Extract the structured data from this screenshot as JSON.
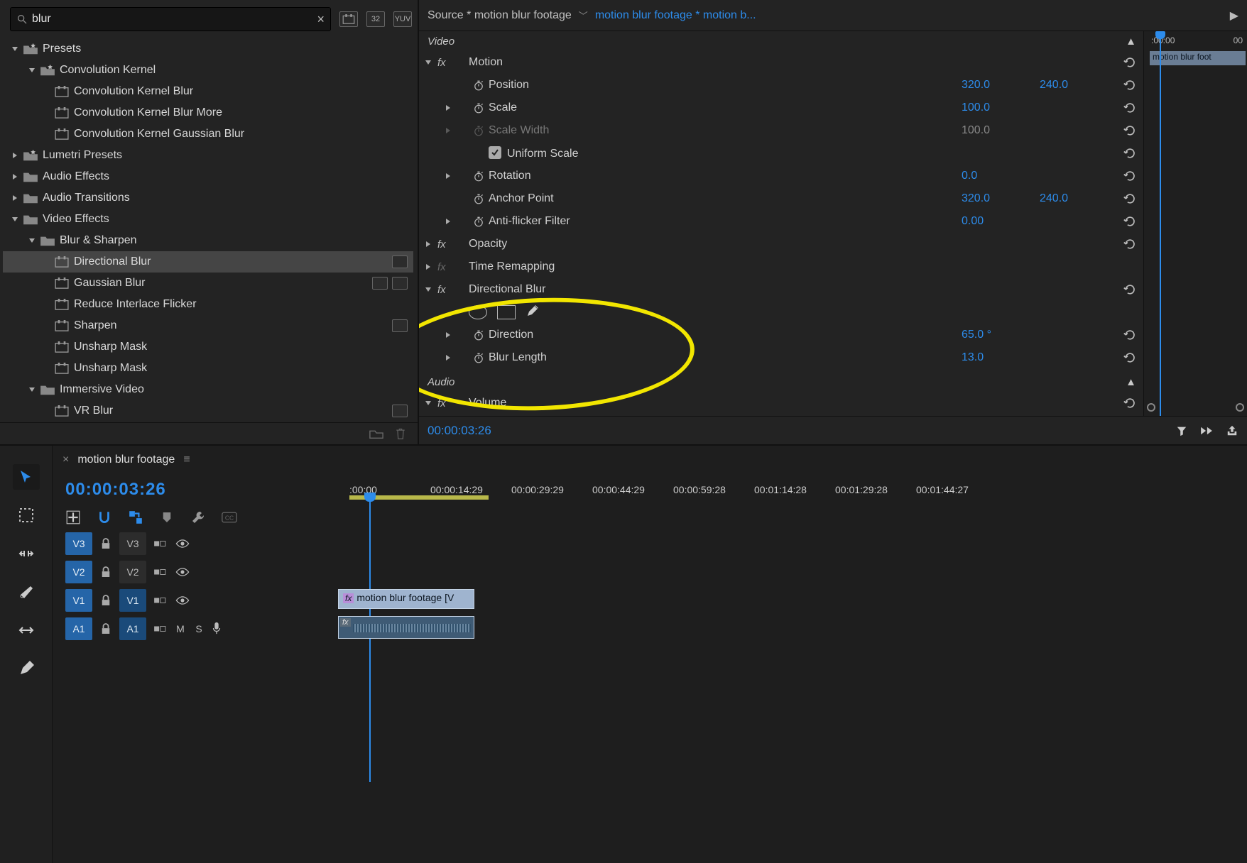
{
  "search": {
    "value": "blur"
  },
  "topbar_badges": [
    "preset",
    "32",
    "YUV"
  ],
  "tree": {
    "presets": "Presets",
    "convKernel": "Convolution Kernel",
    "ckBlur": "Convolution Kernel Blur",
    "ckBlurMore": "Convolution Kernel Blur More",
    "ckGauss": "Convolution Kernel Gaussian Blur",
    "lumetri": "Lumetri Presets",
    "audioFx": "Audio Effects",
    "audioTr": "Audio Transitions",
    "videoFx": "Video Effects",
    "blurSharpen": "Blur & Sharpen",
    "dirBlur": "Directional Blur",
    "gauss": "Gaussian Blur",
    "rif": "Reduce Interlace Flicker",
    "sharpen": "Sharpen",
    "unsharp1": "Unsharp Mask",
    "unsharp2": "Unsharp Mask",
    "immersive": "Immersive Video",
    "vrblur": "VR Blur"
  },
  "ec": {
    "source": "Source * motion blur footage",
    "sequence": "motion blur footage * motion b...",
    "videoLabel": "Video",
    "motion": "Motion",
    "position": "Position",
    "posX": "320.0",
    "posY": "240.0",
    "scale": "Scale",
    "scaleV": "100.0",
    "scaleW": "Scale Width",
    "scaleWV": "100.0",
    "uniform": "Uniform Scale",
    "rotation": "Rotation",
    "rotV": "0.0",
    "anchor": "Anchor Point",
    "anX": "320.0",
    "anY": "240.0",
    "antiF": "Anti-flicker Filter",
    "antiFV": "0.00",
    "opacity": "Opacity",
    "timeRemap": "Time Remapping",
    "dirBlurFx": "Directional Blur",
    "direction": "Direction",
    "dirV": "65.0 °",
    "blurLen": "Blur Length",
    "blV": "13.0",
    "audioLabel": "Audio",
    "volume": "Volume",
    "timecode": "00:00:03:26",
    "miniRuler": {
      "t0": ":00:00",
      "t1": "00"
    },
    "miniClip": "motion blur foot"
  },
  "timeline": {
    "tab": "motion blur footage",
    "timecode": "00:00:03:26",
    "ruler": [
      ":00:00",
      "00:00:14:29",
      "00:00:29:29",
      "00:00:44:29",
      "00:00:59:28",
      "00:01:14:28",
      "00:01:29:28",
      "00:01:44:27"
    ],
    "tracks": {
      "v3": "V3",
      "v2": "V2",
      "v1": "V1",
      "a1": "A1",
      "m": "M",
      "s": "S"
    },
    "clipV": "motion blur footage [V"
  }
}
